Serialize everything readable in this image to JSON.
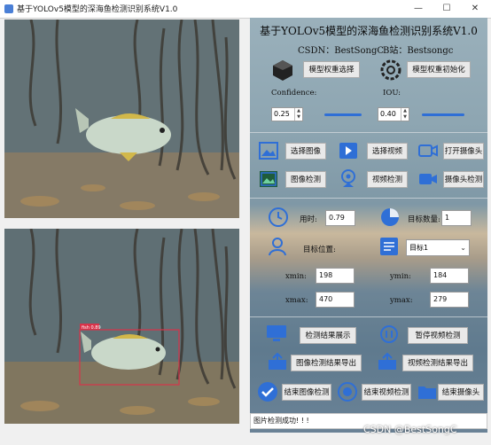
{
  "window": {
    "title": "基于YOLOv5模型的深海鱼检测识别系统V1.0",
    "controls": [
      "—",
      "☐",
      "✕"
    ]
  },
  "panel": {
    "title": "基于YOLOv5模型的深海鱼检测识别系统V1.0",
    "csdn_label": "CSDN：BestSongC",
    "bilibili_label": "B站：Bestsongc",
    "buttons": {
      "model_select": "模型权重选择",
      "model_init": "模型权重初始化",
      "select_image": "选择图像",
      "select_video": "选择视频",
      "open_camera": "打开摄像头",
      "image_detect": "图像检测",
      "video_detect": "视频检测",
      "camera_detect": "摄像头检测",
      "show_result": "检测结果展示",
      "pause_video": "暂停视频检测",
      "export_image": "图像检测结果导出",
      "export_video": "视频检测结果导出",
      "end_image": "结束图像检测",
      "end_video": "结束视频检测",
      "end_camera": "结束摄像头"
    },
    "confidence_label": "Confidence:",
    "confidence_value": "0.25",
    "confidence_level": 0.25,
    "iou_label": "IOU:",
    "iou_value": "0.40",
    "iou_level": 0.4,
    "time_label": "用时:",
    "time_value": "0.79",
    "count_label": "目标数量:",
    "count_value": "1",
    "position_label": "目标位置:",
    "target_select": "目标1",
    "xmin_label": "xmin:",
    "xmin_value": "198",
    "ymin_label": "ymin:",
    "ymin_value": "184",
    "xmax_label": "xmax:",
    "xmax_value": "470",
    "ymax_label": "ymax:",
    "ymax_value": "279"
  },
  "status_text": "图片检测成功! ! !",
  "detection_label": "fish 0.89",
  "watermark": "CSDN @BestSongC",
  "colors": {
    "accent_blue": "#2f6fd6",
    "bbox": "#d8334a",
    "fish_body": "#c9d8c9",
    "fish_fin": "#d2b84a"
  }
}
